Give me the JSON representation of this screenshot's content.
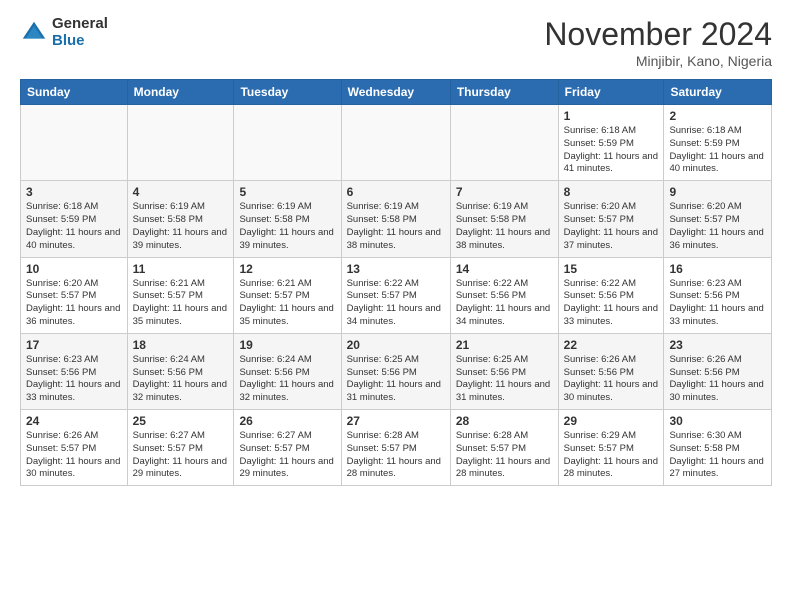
{
  "logo": {
    "general": "General",
    "blue": "Blue"
  },
  "title": "November 2024",
  "location": "Minjibir, Kano, Nigeria",
  "weekdays": [
    "Sunday",
    "Monday",
    "Tuesday",
    "Wednesday",
    "Thursday",
    "Friday",
    "Saturday"
  ],
  "weeks": [
    [
      {
        "day": "",
        "info": ""
      },
      {
        "day": "",
        "info": ""
      },
      {
        "day": "",
        "info": ""
      },
      {
        "day": "",
        "info": ""
      },
      {
        "day": "",
        "info": ""
      },
      {
        "day": "1",
        "info": "Sunrise: 6:18 AM\nSunset: 5:59 PM\nDaylight: 11 hours and 41 minutes."
      },
      {
        "day": "2",
        "info": "Sunrise: 6:18 AM\nSunset: 5:59 PM\nDaylight: 11 hours and 40 minutes."
      }
    ],
    [
      {
        "day": "3",
        "info": "Sunrise: 6:18 AM\nSunset: 5:59 PM\nDaylight: 11 hours and 40 minutes."
      },
      {
        "day": "4",
        "info": "Sunrise: 6:19 AM\nSunset: 5:58 PM\nDaylight: 11 hours and 39 minutes."
      },
      {
        "day": "5",
        "info": "Sunrise: 6:19 AM\nSunset: 5:58 PM\nDaylight: 11 hours and 39 minutes."
      },
      {
        "day": "6",
        "info": "Sunrise: 6:19 AM\nSunset: 5:58 PM\nDaylight: 11 hours and 38 minutes."
      },
      {
        "day": "7",
        "info": "Sunrise: 6:19 AM\nSunset: 5:58 PM\nDaylight: 11 hours and 38 minutes."
      },
      {
        "day": "8",
        "info": "Sunrise: 6:20 AM\nSunset: 5:57 PM\nDaylight: 11 hours and 37 minutes."
      },
      {
        "day": "9",
        "info": "Sunrise: 6:20 AM\nSunset: 5:57 PM\nDaylight: 11 hours and 36 minutes."
      }
    ],
    [
      {
        "day": "10",
        "info": "Sunrise: 6:20 AM\nSunset: 5:57 PM\nDaylight: 11 hours and 36 minutes."
      },
      {
        "day": "11",
        "info": "Sunrise: 6:21 AM\nSunset: 5:57 PM\nDaylight: 11 hours and 35 minutes."
      },
      {
        "day": "12",
        "info": "Sunrise: 6:21 AM\nSunset: 5:57 PM\nDaylight: 11 hours and 35 minutes."
      },
      {
        "day": "13",
        "info": "Sunrise: 6:22 AM\nSunset: 5:57 PM\nDaylight: 11 hours and 34 minutes."
      },
      {
        "day": "14",
        "info": "Sunrise: 6:22 AM\nSunset: 5:56 PM\nDaylight: 11 hours and 34 minutes."
      },
      {
        "day": "15",
        "info": "Sunrise: 6:22 AM\nSunset: 5:56 PM\nDaylight: 11 hours and 33 minutes."
      },
      {
        "day": "16",
        "info": "Sunrise: 6:23 AM\nSunset: 5:56 PM\nDaylight: 11 hours and 33 minutes."
      }
    ],
    [
      {
        "day": "17",
        "info": "Sunrise: 6:23 AM\nSunset: 5:56 PM\nDaylight: 11 hours and 33 minutes."
      },
      {
        "day": "18",
        "info": "Sunrise: 6:24 AM\nSunset: 5:56 PM\nDaylight: 11 hours and 32 minutes."
      },
      {
        "day": "19",
        "info": "Sunrise: 6:24 AM\nSunset: 5:56 PM\nDaylight: 11 hours and 32 minutes."
      },
      {
        "day": "20",
        "info": "Sunrise: 6:25 AM\nSunset: 5:56 PM\nDaylight: 11 hours and 31 minutes."
      },
      {
        "day": "21",
        "info": "Sunrise: 6:25 AM\nSunset: 5:56 PM\nDaylight: 11 hours and 31 minutes."
      },
      {
        "day": "22",
        "info": "Sunrise: 6:26 AM\nSunset: 5:56 PM\nDaylight: 11 hours and 30 minutes."
      },
      {
        "day": "23",
        "info": "Sunrise: 6:26 AM\nSunset: 5:56 PM\nDaylight: 11 hours and 30 minutes."
      }
    ],
    [
      {
        "day": "24",
        "info": "Sunrise: 6:26 AM\nSunset: 5:57 PM\nDaylight: 11 hours and 30 minutes."
      },
      {
        "day": "25",
        "info": "Sunrise: 6:27 AM\nSunset: 5:57 PM\nDaylight: 11 hours and 29 minutes."
      },
      {
        "day": "26",
        "info": "Sunrise: 6:27 AM\nSunset: 5:57 PM\nDaylight: 11 hours and 29 minutes."
      },
      {
        "day": "27",
        "info": "Sunrise: 6:28 AM\nSunset: 5:57 PM\nDaylight: 11 hours and 28 minutes."
      },
      {
        "day": "28",
        "info": "Sunrise: 6:28 AM\nSunset: 5:57 PM\nDaylight: 11 hours and 28 minutes."
      },
      {
        "day": "29",
        "info": "Sunrise: 6:29 AM\nSunset: 5:57 PM\nDaylight: 11 hours and 28 minutes."
      },
      {
        "day": "30",
        "info": "Sunrise: 6:30 AM\nSunset: 5:58 PM\nDaylight: 11 hours and 27 minutes."
      }
    ]
  ]
}
